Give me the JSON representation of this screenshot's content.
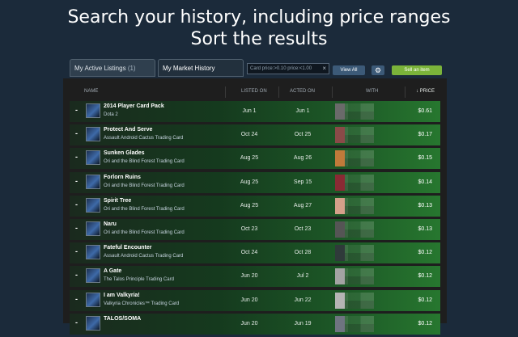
{
  "headline": {
    "line1": "Search your history, including price ranges",
    "line2": "Sort the results"
  },
  "tabs": {
    "active_listings_label": "My Active Listings",
    "active_listings_count": "(1)",
    "market_history_label": "My Market History"
  },
  "search": {
    "value": "Card price:>0.10 price:<1.00",
    "clear_icon": "close-icon"
  },
  "buttons": {
    "view_all": "View All",
    "gear_icon": "gear-icon",
    "sell": "Sell an item"
  },
  "columns": {
    "name": "NAME",
    "listed": "LISTED ON",
    "acted": "ACTED ON",
    "with": "WITH",
    "price": "↓ PRICE"
  },
  "colors": {
    "accent_green": "#7bb33a",
    "background": "#1b2a3a",
    "row_green": "#27772f"
  },
  "rows": [
    {
      "dash": "-",
      "name": "2014 Player Card Pack",
      "game": "Dota 2",
      "listed": "Jun 1",
      "acted": "Jun 1",
      "price": "$0.61",
      "avatar": "#6a6a6a"
    },
    {
      "dash": "-",
      "name": "Protect And Serve",
      "game": "Assault Android Cactus Trading Card",
      "listed": "Oct 24",
      "acted": "Oct 25",
      "price": "$0.17",
      "avatar": "#8a4a48"
    },
    {
      "dash": "-",
      "name": "Sunken Glades",
      "game": "Ori and the Blind Forest Trading Card",
      "listed": "Aug 25",
      "acted": "Aug 26",
      "price": "$0.15",
      "avatar": "#c07a3a"
    },
    {
      "dash": "-",
      "name": "Forlorn Ruins",
      "game": "Ori and the Blind Forest Trading Card",
      "listed": "Aug 25",
      "acted": "Sep 15",
      "price": "$0.14",
      "avatar": "#8a2a34"
    },
    {
      "dash": "-",
      "name": "Spirit Tree",
      "game": "Ori and the Blind Forest Trading Card",
      "listed": "Aug 25",
      "acted": "Aug 27",
      "price": "$0.13",
      "avatar": "#d4a08a"
    },
    {
      "dash": "-",
      "name": "Naru",
      "game": "Ori and the Blind Forest Trading Card",
      "listed": "Oct 23",
      "acted": "Oct 23",
      "price": "$0.13",
      "avatar": "#555555"
    },
    {
      "dash": "-",
      "name": "Fateful Encounter",
      "game": "Assault Android Cactus Trading Card",
      "listed": "Oct 24",
      "acted": "Oct 28",
      "price": "$0.12",
      "avatar": "#2f3a3a"
    },
    {
      "dash": "-",
      "name": "A Gate",
      "game": "The Talos Principle Trading Card",
      "listed": "Jun 20",
      "acted": "Jul 2",
      "price": "$0.12",
      "avatar": "#a3a3a3"
    },
    {
      "dash": "-",
      "name": "I am Valkyria!",
      "game": "Valkyria Chronicles™ Trading Card",
      "listed": "Jun 20",
      "acted": "Jun 22",
      "price": "$0.12",
      "avatar": "#b4b4b4"
    },
    {
      "dash": "-",
      "name": "TALOS/SOMA",
      "game": "",
      "listed": "Jun 20",
      "acted": "Jun 19",
      "price": "$0.12",
      "avatar": "#6e7480"
    }
  ]
}
